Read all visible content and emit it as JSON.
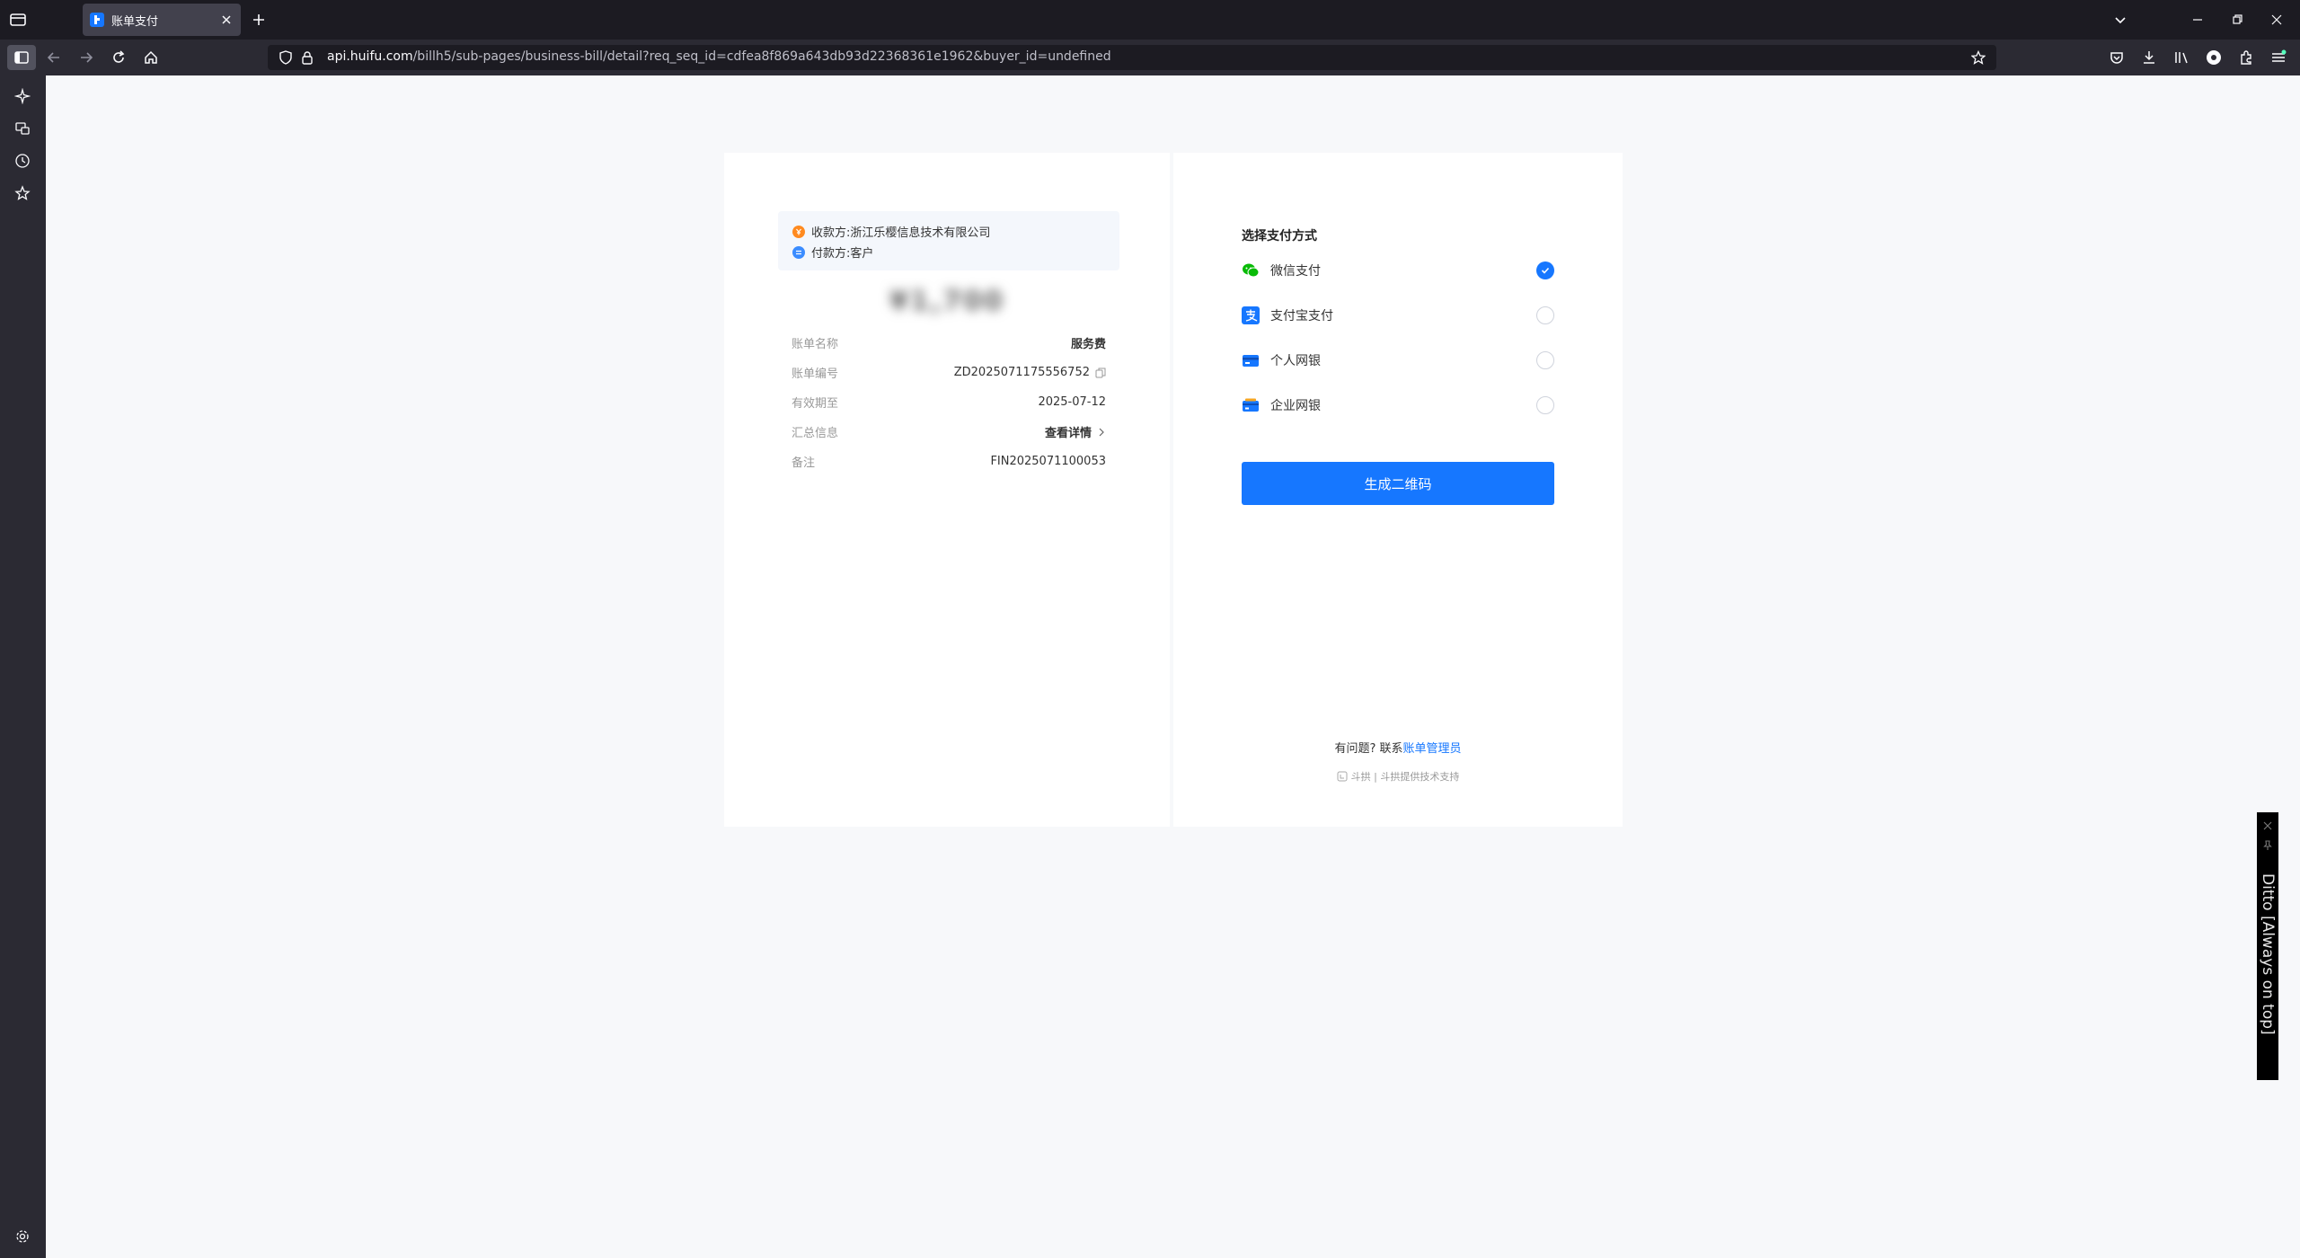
{
  "browser": {
    "tab_title": "账单支付",
    "url_host": "api.huifu.com",
    "url_path": "/billh5/sub-pages/business-bill/detail?req_seq_id=cdfea8f869a643db93d22368361e1962&buyer_id=undefined"
  },
  "bill": {
    "payee_label": "收款方:",
    "payee_value": "浙江乐樱信息技术有限公司",
    "payer_label": "付款方:",
    "payer_value": "客户",
    "amount": "¥1,700",
    "rows": [
      {
        "label": "账单名称",
        "value": "服务费"
      },
      {
        "label": "账单编号",
        "value": "ZD2025071175556752"
      },
      {
        "label": "有效期至",
        "value": "2025-07-12"
      },
      {
        "label": "汇总信息",
        "value": "查看详情"
      },
      {
        "label": "备注",
        "value": "FIN2025071100053"
      }
    ]
  },
  "payment": {
    "title": "选择支付方式",
    "methods": [
      {
        "label": "微信支付",
        "icon": "wechat-pay-icon",
        "selected": true
      },
      {
        "label": "支付宝支付",
        "icon": "alipay-icon",
        "selected": false
      },
      {
        "label": "个人网银",
        "icon": "personal-bank-card-icon",
        "selected": false
      },
      {
        "label": "企业网银",
        "icon": "enterprise-bank-card-icon",
        "selected": false
      }
    ],
    "generate_button": "生成二维码",
    "help_prefix": "有问题? 联系",
    "help_link": "账单管理员",
    "support_text": "斗拱 | 斗拱提供技术支持"
  },
  "ditto": {
    "text": "Ditto [Always on top]"
  },
  "colors": {
    "primary": "#1677ff",
    "wechat_green": "#09bb07",
    "page_bg": "#f7f8fa",
    "chrome_dark": "#1c1b22"
  }
}
